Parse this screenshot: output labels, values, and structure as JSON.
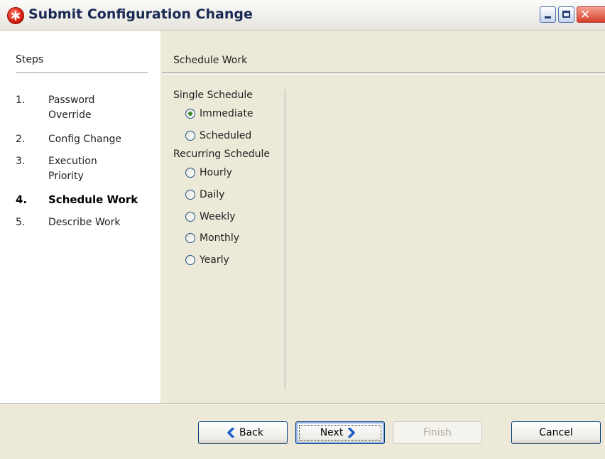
{
  "window": {
    "title": "Submit Configuration Change",
    "close_glyph": "✕"
  },
  "steps": {
    "header": "Steps",
    "items": [
      {
        "num": "1.",
        "label": "Password Override"
      },
      {
        "num": "2.",
        "label": "Config Change"
      },
      {
        "num": "3.",
        "label": "Execution Priority"
      },
      {
        "num": "4.",
        "label": "Schedule Work",
        "active": true
      },
      {
        "num": "5.",
        "label": "Describe Work"
      }
    ]
  },
  "content": {
    "header": "Schedule Work",
    "single_schedule": {
      "label": "Single Schedule",
      "options": [
        "Immediate",
        "Scheduled"
      ],
      "selected": "Immediate"
    },
    "recurring_schedule": {
      "label": "Recurring Schedule",
      "options": [
        "Hourly",
        "Daily",
        "Weekly",
        "Monthly",
        "Yearly"
      ]
    }
  },
  "buttons": {
    "back": "Back",
    "next": "Next",
    "finish": "Finish",
    "cancel": "Cancel"
  },
  "colors": {
    "accent": "#1c5180",
    "selected_dot": "#3d8a2a",
    "app_icon": "#d91e0f"
  },
  "icons": {
    "app": "red-asterisk-icon",
    "back": "chevron-left-icon",
    "next": "chevron-right-icon"
  }
}
